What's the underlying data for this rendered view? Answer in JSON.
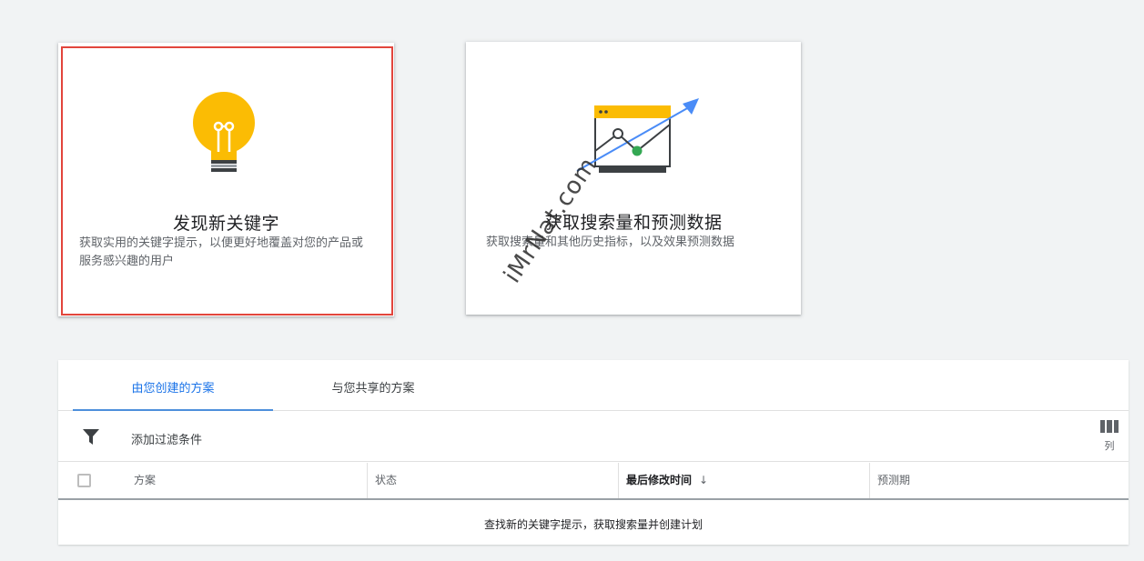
{
  "cards": {
    "discover": {
      "title": "发现新关键字",
      "description": "获取实用的关键字提示，以便更好地覆盖对您的产品或服务感兴趣的用户",
      "icon": "lightbulb-icon"
    },
    "forecast": {
      "title": "获取搜索量和预测数据",
      "description": "获取搜索量和其他历史指标，以及效果预测数据",
      "icon": "trend-chart-icon"
    }
  },
  "tabs": [
    {
      "label": "由您创建的方案",
      "active": true
    },
    {
      "label": "与您共享的方案",
      "active": false
    }
  ],
  "filter": {
    "label": "添加过滤条件",
    "icon": "filter-icon"
  },
  "columns_button": {
    "label": "列",
    "icon": "columns-icon"
  },
  "table": {
    "headers": [
      "方案",
      "状态",
      "最后修改时间",
      "预测期"
    ],
    "sorted_column": "最后修改时间",
    "sort_direction": "descending",
    "empty_message": "查找新的关键字提示，获取搜索量并创建计划"
  },
  "watermark": "iMrNat.com",
  "colors": {
    "accent_blue": "#1a73e8",
    "highlight_red": "#e2453c",
    "bulb_yellow": "#fbbc04",
    "chart_green": "#34a853"
  }
}
